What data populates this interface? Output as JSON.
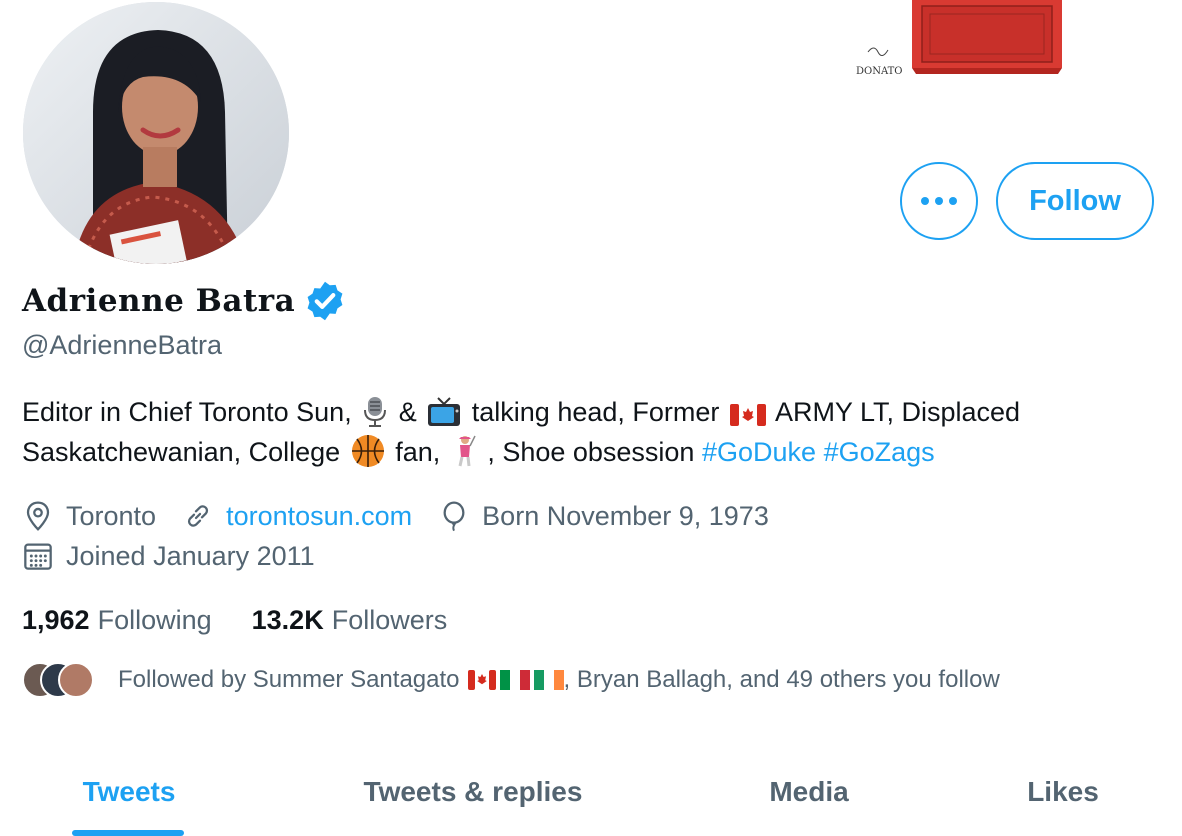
{
  "profile": {
    "display_name": "Adrienne Batra",
    "handle": "@AdrienneBatra",
    "bio": {
      "part1": "Editor in Chief Toronto Sun,",
      "part2": "&",
      "part3": "talking head, Former",
      "part4": "ARMY LT, Displaced Saskatchewanian, College",
      "part5": "fan,",
      "part6": ", Shoe obsession",
      "hashtag1": "#GoDuke",
      "hashtag2": "#GoZags"
    },
    "location": "Toronto",
    "website": "torontosun.com",
    "birthday": "Born November 9, 1973",
    "joined": "Joined January 2011"
  },
  "actions": {
    "follow_label": "Follow"
  },
  "stats": {
    "following_count": "1,962",
    "following_label": "Following",
    "followers_count": "13.2K",
    "followers_label": "Followers"
  },
  "followed_by": {
    "prefix": "Followed by Summer Santagato",
    "suffix": ", Bryan Ballagh, and 49 others you follow"
  },
  "tabs": [
    {
      "label": "Tweets",
      "active": true
    },
    {
      "label": "Tweets & replies",
      "active": false
    },
    {
      "label": "Media",
      "active": false
    },
    {
      "label": "Likes",
      "active": false
    }
  ],
  "banner_signature": "DONATO",
  "icons": {
    "more": "more-horizontal-icon",
    "verified": "verified-badge-icon",
    "location": "location-pin-icon",
    "link": "link-icon",
    "birthday": "balloon-icon",
    "joined": "calendar-icon",
    "bio_emoji": [
      "microphone-icon",
      "television-icon",
      "canada-flag-icon",
      "basketball-icon",
      "golfer-icon"
    ],
    "follower_flags": [
      "canada-flag-icon",
      "italy-flag-icon",
      "ireland-flag-icon"
    ]
  },
  "colors": {
    "accent": "#1da1f2",
    "text_primary": "#0f1419",
    "text_secondary": "#536471"
  }
}
